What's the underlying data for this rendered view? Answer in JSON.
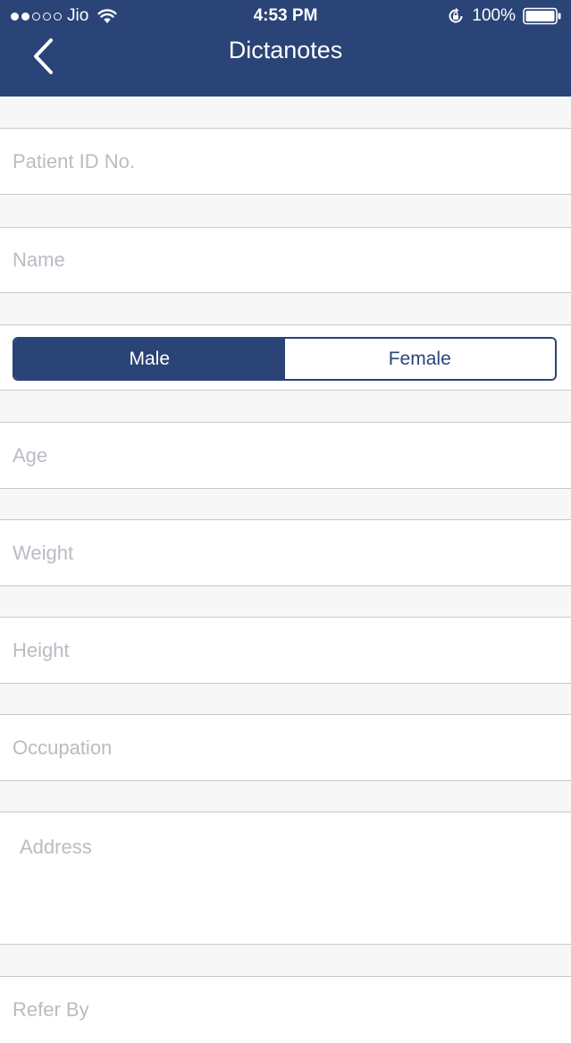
{
  "status_bar": {
    "carrier": "Jio",
    "time": "4:53 PM",
    "battery": "100%",
    "icons": [
      "signal-dots-icon",
      "wifi-icon",
      "orientation-lock-icon",
      "battery-icon"
    ]
  },
  "nav": {
    "title": "Dictanotes",
    "back_icon": "chevron-left-icon"
  },
  "form": {
    "patient_id": {
      "placeholder": "Patient ID No.",
      "value": ""
    },
    "name": {
      "placeholder": "Name",
      "value": ""
    },
    "gender": {
      "options": [
        "Male",
        "Female"
      ],
      "selected": "Male"
    },
    "age": {
      "placeholder": "Age",
      "value": ""
    },
    "weight": {
      "placeholder": "Weight",
      "value": ""
    },
    "height": {
      "placeholder": "Height",
      "value": ""
    },
    "occupation": {
      "placeholder": "Occupation",
      "value": ""
    },
    "address": {
      "placeholder": "Address",
      "value": ""
    },
    "refer_by": {
      "placeholder": "Refer By",
      "value": ""
    }
  },
  "colors": {
    "primary": "#2b4477",
    "background": "#f7f7f7",
    "placeholder": "#b9bcc3",
    "divider": "#c8c8cc"
  }
}
